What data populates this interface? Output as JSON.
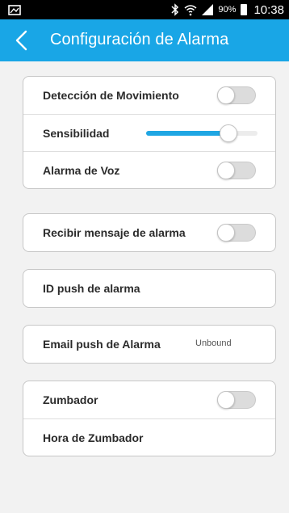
{
  "statusbar": {
    "battery_pct": "90%",
    "time": "10:38",
    "icons": [
      "gallery-icon",
      "bluetooth-icon",
      "wifi-icon",
      "signal-icon",
      "battery-icon"
    ]
  },
  "appbar": {
    "title": "Configuración de Alarma",
    "back_icon": "chevron-left-icon",
    "color": "#19a6e6"
  },
  "sections": {
    "motion": {
      "motion_detection_label": "Detección de Movimiento",
      "motion_detection_on": false,
      "sensitivity_label": "Sensibilidad",
      "sensitivity_level": 0.74,
      "voice_alarm_label": "Alarma de Voz",
      "voice_alarm_on": false
    },
    "message": {
      "receive_alarm_label": "Recibir mensaje de alarma",
      "receive_alarm_on": false
    },
    "push_id": {
      "label": "ID push de alarma"
    },
    "email": {
      "label": "Email push de Alarma",
      "value": "Unbound"
    },
    "buzzer": {
      "buzzer_label": "Zumbador",
      "buzzer_on": false,
      "buzzer_time_label": "Hora de Zumbador"
    }
  }
}
